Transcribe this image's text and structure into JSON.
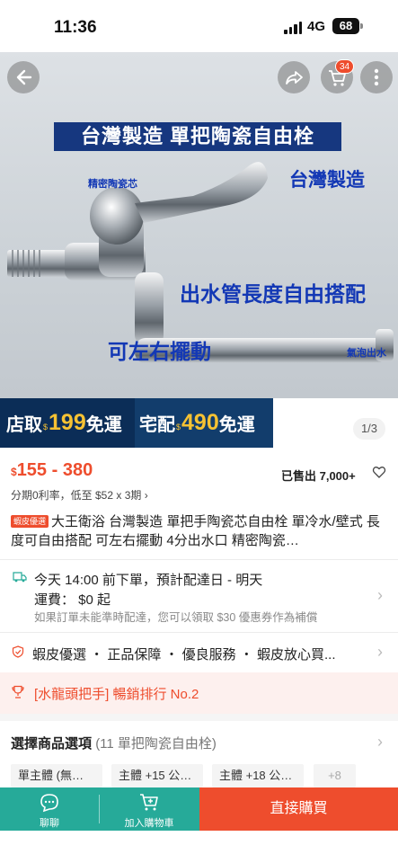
{
  "status": {
    "time": "11:36",
    "network": "4G",
    "battery": "68"
  },
  "hero": {
    "banner": "台灣製造 單把陶瓷自由栓",
    "caption_core": "精密陶瓷芯",
    "caption_taiwan": "台灣製造",
    "caption_pipe": "出水管長度自由搭配",
    "caption_swing": "可左右擺動",
    "caption_bubble": "氣泡出水",
    "cart_count": "34",
    "page_indicator": "1/3"
  },
  "promo": {
    "pickup_label": "店取",
    "pickup_currency": "$",
    "pickup_amount": "199",
    "pickup_free": "免運",
    "home_label": "宅配",
    "home_currency": "$",
    "home_amount": "490",
    "home_free": "免運"
  },
  "price": {
    "currency": "$",
    "range": "155 - 380",
    "sold": "已售出 7,000+",
    "installment": "分期0利率，低至 $52 x 3期 ›"
  },
  "product": {
    "badge": "蝦皮優選",
    "title": "大王衛浴 台灣製造 單把手陶瓷芯自由栓 單冷水/壁式 長度可自由搭配 可左右擺動 4分出水口 精密陶瓷…"
  },
  "shipping": {
    "line1": "今天 14:00 前下單，預計配達日 - 明天",
    "line2": "運費： $0 起",
    "line3": "如果訂單未能準時配達，您可以領取 $30 優惠券作為補償"
  },
  "guarantee": "蝦皮優選 ・ 正品保障 ・ 優良服務 ・ 蝦皮放心買...",
  "ranking": "[水龍頭把手] 暢銷排行 No.2",
  "options": {
    "title": "選擇商品選項",
    "count": "(11 單把陶瓷自由栓)",
    "chips": [
      "單主體 (無…",
      "主體 +15 公…",
      "主體 +18 公…",
      "+8"
    ]
  },
  "bottom": {
    "chat": "聊聊",
    "add_cart": "加入購物車",
    "buy_now": "直接購買"
  },
  "colors": {
    "accent": "#ee4d2d",
    "teal": "#26aa99",
    "caption_blue": "#1338b5",
    "banner_navy": "#16377f"
  }
}
